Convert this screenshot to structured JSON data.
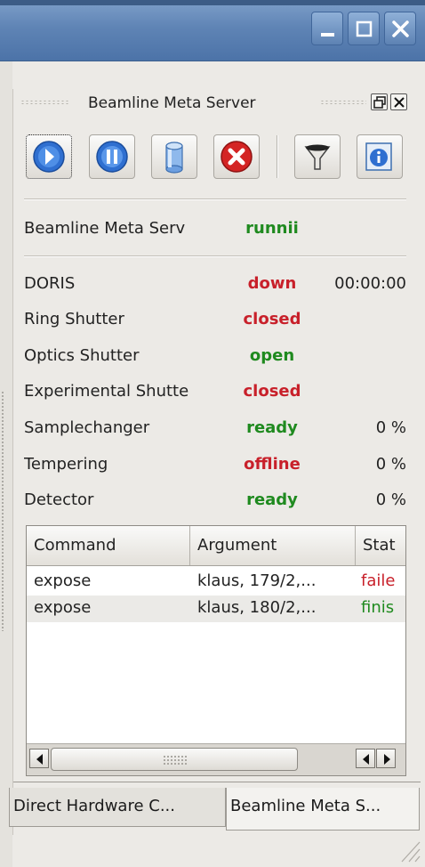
{
  "window": {
    "buttons": [
      "minimize-icon",
      "maximize-icon",
      "close-icon"
    ]
  },
  "dock": {
    "title": "Beamline Meta Server"
  },
  "toolbar": {
    "buttons": [
      "start-icon",
      "pause-icon",
      "database-icon",
      "stop-icon",
      "filter-icon",
      "info-icon"
    ]
  },
  "server_row": {
    "label": "Beamline Meta Serv",
    "status": "runnii",
    "status_color": "#1f8a1f"
  },
  "devices": [
    {
      "label": "DORIS",
      "status": "down",
      "status_color": "#c8202a",
      "extra": "00:00:00"
    },
    {
      "label": "Ring Shutter",
      "status": "closed",
      "status_color": "#c8202a",
      "extra": ""
    },
    {
      "label": "Optics Shutter",
      "status": "open",
      "status_color": "#1f8a1f",
      "extra": ""
    },
    {
      "label": "Experimental Shutte",
      "status": "closed",
      "status_color": "#c8202a",
      "extra": ""
    },
    {
      "label": "Samplechanger",
      "status": "ready",
      "status_color": "#1f8a1f",
      "extra": "0 %"
    },
    {
      "label": "Tempering",
      "status": "offline",
      "status_color": "#c8202a",
      "extra": "0 %"
    },
    {
      "label": "Detector",
      "status": "ready",
      "status_color": "#1f8a1f",
      "extra": "0 %"
    }
  ],
  "commands": {
    "headers": [
      "Command",
      "Argument",
      "Stat"
    ],
    "rows": [
      {
        "command": "expose",
        "argument": "klaus, 179/2,...",
        "status": "faile",
        "status_color": "#c8202a"
      },
      {
        "command": "expose",
        "argument": "klaus, 180/2,...",
        "status": "finis",
        "status_color": "#1f8a1f"
      }
    ]
  },
  "tabs": [
    {
      "label": "Direct Hardware C...",
      "active": false
    },
    {
      "label": "Beamline Meta S...",
      "active": true
    }
  ]
}
